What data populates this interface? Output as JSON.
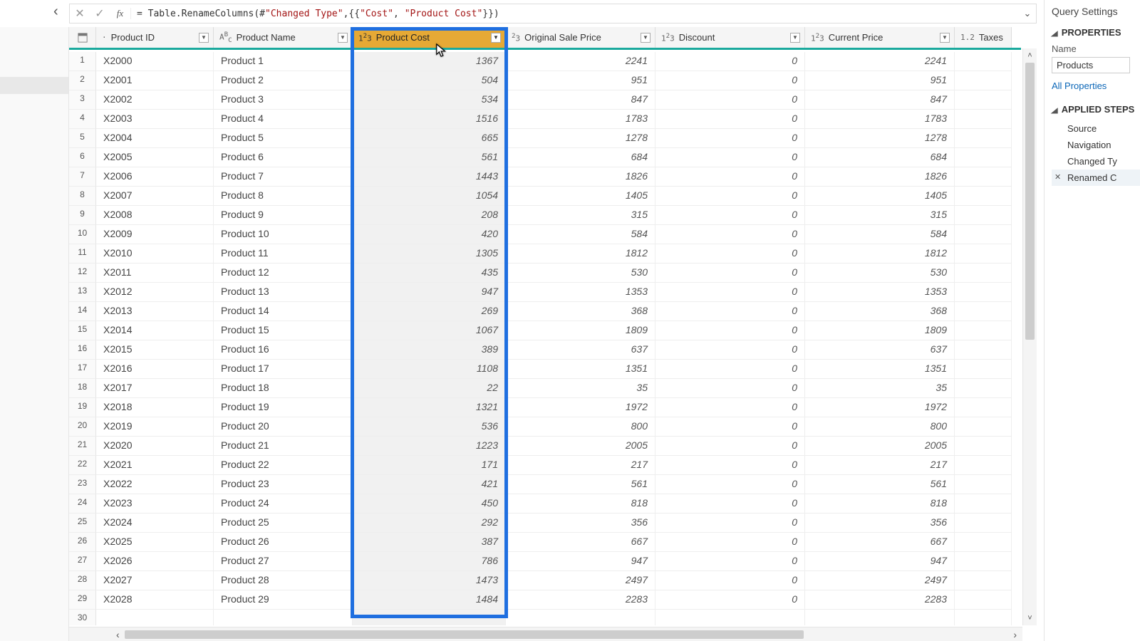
{
  "formula_bar": {
    "text_prefix": "= Table.RenameColumns(#",
    "text_arg1": "\"Changed Type\"",
    "text_mid": ",{{",
    "text_s1": "\"Cost\"",
    "text_sep": ", ",
    "text_s2": "\"Product Cost\"",
    "text_suffix": "}})"
  },
  "settings": {
    "title": "Query Settings",
    "properties_label": "PROPERTIES",
    "name_label": "Name",
    "name_value": "Products",
    "all_props": "All Properties",
    "applied_label": "APPLIED STEPS",
    "steps": [
      "Source",
      "Navigation",
      "Changed Ty",
      "Renamed C"
    ]
  },
  "columns": [
    {
      "key": "id",
      "type": ".",
      "label": "Product ID"
    },
    {
      "key": "name",
      "type": "ABC",
      "label": "Product Name"
    },
    {
      "key": "cost",
      "type": "1²3",
      "label": "Product Cost",
      "selected": true
    },
    {
      "key": "orig",
      "type": "²3",
      "label": "Original Sale Price"
    },
    {
      "key": "disc",
      "type": "1²3",
      "label": "Discount"
    },
    {
      "key": "curr",
      "type": "1²3",
      "label": "Current Price"
    },
    {
      "key": "tax",
      "type": "1.2",
      "label": "Taxes"
    }
  ],
  "chart_data": {
    "type": "table",
    "columns": [
      "Row",
      "Product ID",
      "Product Name",
      "Product Cost",
      "Original Sale Price",
      "Discount",
      "Current Price"
    ],
    "rows": [
      [
        1,
        "X2000",
        "Product 1",
        1367,
        2241,
        0,
        2241
      ],
      [
        2,
        "X2001",
        "Product 2",
        504,
        951,
        0,
        951
      ],
      [
        3,
        "X2002",
        "Product 3",
        534,
        847,
        0,
        847
      ],
      [
        4,
        "X2003",
        "Product 4",
        1516,
        1783,
        0,
        1783
      ],
      [
        5,
        "X2004",
        "Product 5",
        665,
        1278,
        0,
        1278
      ],
      [
        6,
        "X2005",
        "Product 6",
        561,
        684,
        0,
        684
      ],
      [
        7,
        "X2006",
        "Product 7",
        1443,
        1826,
        0,
        1826
      ],
      [
        8,
        "X2007",
        "Product 8",
        1054,
        1405,
        0,
        1405
      ],
      [
        9,
        "X2008",
        "Product 9",
        208,
        315,
        0,
        315
      ],
      [
        10,
        "X2009",
        "Product 10",
        420,
        584,
        0,
        584
      ],
      [
        11,
        "X2010",
        "Product 11",
        1305,
        1812,
        0,
        1812
      ],
      [
        12,
        "X2011",
        "Product 12",
        435,
        530,
        0,
        530
      ],
      [
        13,
        "X2012",
        "Product 13",
        947,
        1353,
        0,
        1353
      ],
      [
        14,
        "X2013",
        "Product 14",
        269,
        368,
        0,
        368
      ],
      [
        15,
        "X2014",
        "Product 15",
        1067,
        1809,
        0,
        1809
      ],
      [
        16,
        "X2015",
        "Product 16",
        389,
        637,
        0,
        637
      ],
      [
        17,
        "X2016",
        "Product 17",
        1108,
        1351,
        0,
        1351
      ],
      [
        18,
        "X2017",
        "Product 18",
        22,
        35,
        0,
        35
      ],
      [
        19,
        "X2018",
        "Product 19",
        1321,
        1972,
        0,
        1972
      ],
      [
        20,
        "X2019",
        "Product 20",
        536,
        800,
        0,
        800
      ],
      [
        21,
        "X2020",
        "Product 21",
        1223,
        2005,
        0,
        2005
      ],
      [
        22,
        "X2021",
        "Product 22",
        171,
        217,
        0,
        217
      ],
      [
        23,
        "X2022",
        "Product 23",
        421,
        561,
        0,
        561
      ],
      [
        24,
        "X2023",
        "Product 24",
        450,
        818,
        0,
        818
      ],
      [
        25,
        "X2024",
        "Product 25",
        292,
        356,
        0,
        356
      ],
      [
        26,
        "X2025",
        "Product 26",
        387,
        667,
        0,
        667
      ],
      [
        27,
        "X2026",
        "Product 27",
        786,
        947,
        0,
        947
      ],
      [
        28,
        "X2027",
        "Product 28",
        1473,
        2497,
        0,
        2497
      ],
      [
        29,
        "X2028",
        "Product 29",
        1484,
        2283,
        0,
        2283
      ],
      [
        30,
        "",
        "",
        null,
        null,
        null,
        null
      ]
    ]
  }
}
